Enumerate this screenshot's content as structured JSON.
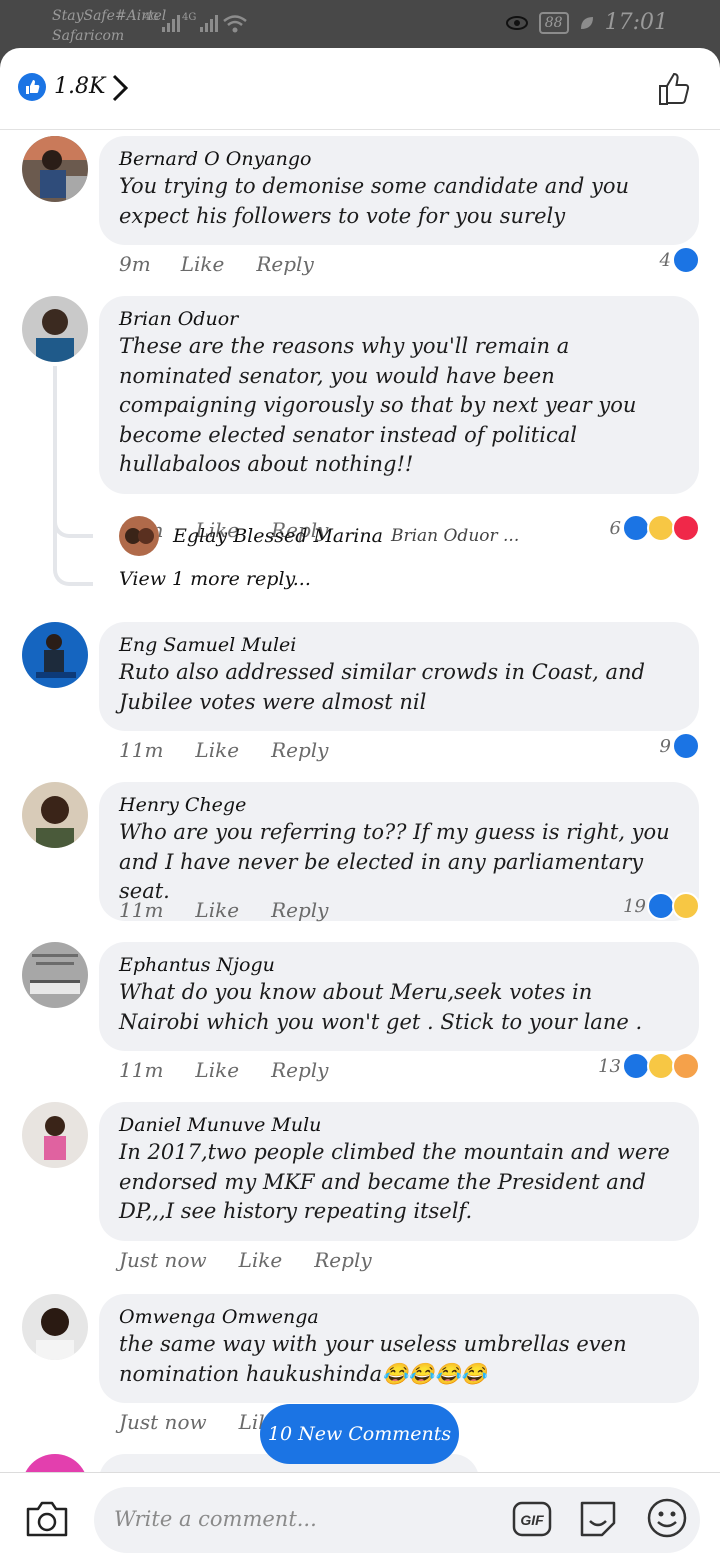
{
  "status_bar": {
    "carrier_1": "StaySafe#Airtel",
    "carrier_2": "Safaricom",
    "signal_label_1": "4G",
    "signal_label_2": "4G",
    "battery": "88",
    "time": "17:01"
  },
  "header": {
    "reaction_count": "1.8K"
  },
  "comments": [
    {
      "name": "Bernard O Onyango",
      "text": "You trying to demonise some candidate and you expect his followers to vote for you surely",
      "time": "9m",
      "like": "Like",
      "reply": "Reply",
      "reaction_count": "4"
    },
    {
      "name": "Brian Oduor",
      "text": "These are the reasons why you'll remain a nominated senator, you would have been compaigning vigorously so that by next year you become elected senator instead of political hullabaloos about nothing!!",
      "time": "10m",
      "like": "Like",
      "reply": "Reply",
      "reaction_count": "6"
    },
    {
      "name": "Eng Samuel Mulei",
      "text": "Ruto also addressed similar crowds in Coast, and Jubilee votes were almost nil",
      "time": "11m",
      "like": "Like",
      "reply": "Reply",
      "reaction_count": "9"
    },
    {
      "name": "Henry Chege",
      "text": "Who are you referring to?? If my guess is right, you and I have never be elected in any parliamentary seat.",
      "time": "11m",
      "like": "Like",
      "reply": "Reply",
      "reaction_count": "19"
    },
    {
      "name": "Ephantus Njogu",
      "text": "What do you know about Meru,seek votes in Nairobi which you won't get . Stick to your lane .",
      "time": "11m",
      "like": "Like",
      "reply": "Reply",
      "reaction_count": "13"
    },
    {
      "name": "Daniel Munuve Mulu",
      "text": "In 2017,two people climbed the mountain and were endorsed my MKF and became the President and DP,,,I see history repeating itself.",
      "time": "Just now",
      "like": "Like",
      "reply": "Reply"
    },
    {
      "name": "Omwenga Omwenga",
      "text": "the same way with your useless umbrellas even nomination haukushinda😂😂😂😂",
      "time": "Just now",
      "like": "Like"
    }
  ],
  "reply": {
    "name": "Eglay Blessed Marina",
    "tag": "Brian Oduor ...",
    "view_more": "View 1 more reply..."
  },
  "new_comments_button": "10 New Comments",
  "composer": {
    "placeholder": "Write a comment...",
    "gif_label": "GIF"
  },
  "colors": {
    "like_blue": "#1b74e4",
    "love_red": "#f02849",
    "haha_yellow": "#f7c744",
    "bubble_bg": "#f0f1f4"
  },
  "icons": [
    "like-icon",
    "chevron-right-icon",
    "thumbs-up-outline-icon",
    "camera-icon",
    "gif-icon",
    "sticker-icon",
    "emoji-icon",
    "haha-icon",
    "love-icon",
    "care-icon"
  ]
}
